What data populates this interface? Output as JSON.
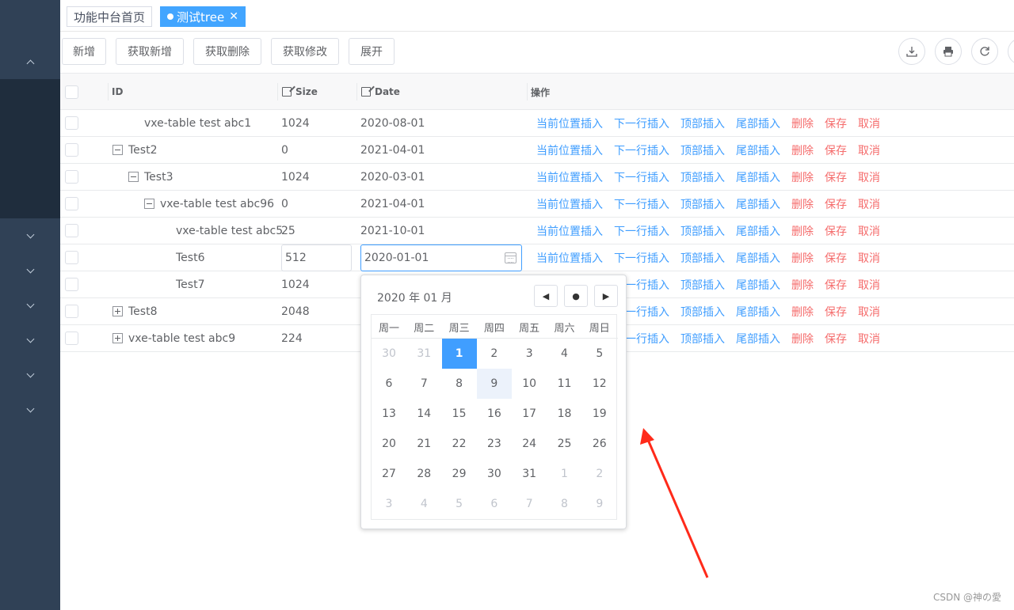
{
  "tabs": [
    {
      "label": "功能中台首页"
    },
    {
      "label": "测试tree"
    }
  ],
  "toolbar": {
    "buttons": [
      "新增",
      "获取新增",
      "获取删除",
      "获取修改",
      "展开"
    ]
  },
  "table": {
    "columns": {
      "id": "ID",
      "size": "Size",
      "date": "Date",
      "ops": "操作"
    },
    "ops": [
      "当前位置插入",
      "下一行插入",
      "顶部插入",
      "尾部插入",
      "删除",
      "保存",
      "取消"
    ],
    "rows": [
      {
        "id": "vxe-table test abc1",
        "size": "1024",
        "date": "2020-08-01"
      },
      {
        "id": "Test2",
        "size": "0",
        "date": "2021-04-01"
      },
      {
        "id": "Test3",
        "size": "1024",
        "date": "2020-03-01"
      },
      {
        "id": "vxe-table test abc96",
        "size": "0",
        "date": "2021-04-01"
      },
      {
        "id": "vxe-table test abc5",
        "size": "25",
        "date": "2021-10-01"
      },
      {
        "id": "Test6",
        "size": "512",
        "date": "2020-01-01"
      },
      {
        "id": "Test7",
        "size": "1024",
        "date": ""
      },
      {
        "id": "Test8",
        "size": "2048",
        "date": ""
      },
      {
        "id": "vxe-table test abc9",
        "size": "224",
        "date": ""
      }
    ]
  },
  "picker": {
    "title": "2020 年 01 月",
    "weekdays": [
      "周一",
      "周二",
      "周三",
      "周四",
      "周五",
      "周六",
      "周日"
    ],
    "days": [
      [
        "30",
        "31",
        "1",
        "2",
        "3",
        "4",
        "5"
      ],
      [
        "6",
        "7",
        "8",
        "9",
        "10",
        "11",
        "12"
      ],
      [
        "13",
        "14",
        "15",
        "16",
        "17",
        "18",
        "19"
      ],
      [
        "20",
        "21",
        "22",
        "23",
        "24",
        "25",
        "26"
      ],
      [
        "27",
        "28",
        "29",
        "30",
        "31",
        "1",
        "2"
      ],
      [
        "3",
        "4",
        "5",
        "6",
        "7",
        "8",
        "9"
      ]
    ]
  },
  "watermark": "CSDN @神の愛"
}
